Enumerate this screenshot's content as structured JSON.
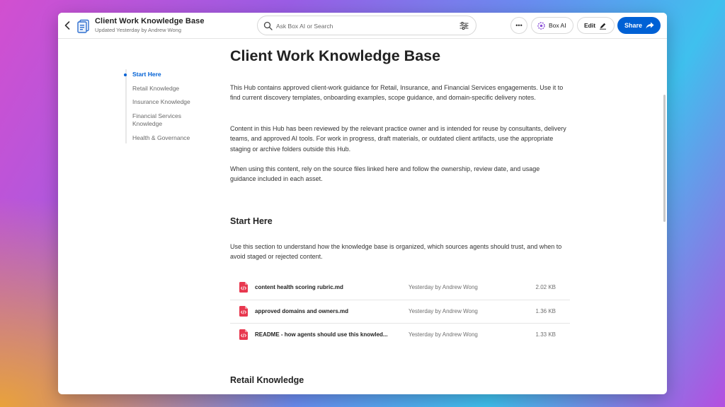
{
  "header": {
    "title": "Client Work Knowledge Base",
    "subtitle": "Updated Yesterday by Andrew Wong",
    "search_placeholder": "Ask Box AI or Search",
    "more_label": "•••",
    "boxai_label": "Box AI",
    "edit_label": "Edit",
    "share_label": "Share"
  },
  "toc": [
    {
      "label": "Start Here",
      "active": true
    },
    {
      "label": "Retail Knowledge",
      "active": false
    },
    {
      "label": "Insurance Knowledge",
      "active": false
    },
    {
      "label": "Financial Services Knowledge",
      "active": false
    },
    {
      "label": "Health & Governance",
      "active": false
    }
  ],
  "content": {
    "heading": "Client Work Knowledge Base",
    "paragraphs": [
      "This Hub contains approved client-work guidance for Retail, Insurance, and Financial Services engagements. Use it to find current discovery templates, onboarding examples, scope guidance, and domain-specific delivery notes.",
      "Content in this Hub has been reviewed by the relevant practice owner and is intended for reuse by consultants, delivery teams, and approved AI tools. For work in progress, draft materials, or outdated client artifacts, use the appropriate staging or archive folders outside this Hub.",
      "When using this content, rely on the source files linked here and follow the ownership, review date, and usage guidance included in each asset."
    ],
    "start_here": {
      "heading": "Start Here",
      "description": "Use this section to understand how the knowledge base is organized, which sources agents should trust, and when to avoid staged or rejected content.",
      "files": [
        {
          "name": "content health scoring rubric.md",
          "modified": "Yesterday by Andrew Wong",
          "size": "2.02 KB"
        },
        {
          "name": "approved domains and owners.md",
          "modified": "Yesterday by Andrew Wong",
          "size": "1.36 KB"
        },
        {
          "name": "README - how agents should use this knowled...",
          "modified": "Yesterday by Andrew Wong",
          "size": "1.33 KB"
        }
      ]
    },
    "retail_heading": "Retail Knowledge"
  },
  "colors": {
    "accent": "#0061d5",
    "file_icon": "#e8384f",
    "boxai_icon": "#8a4fd8"
  }
}
